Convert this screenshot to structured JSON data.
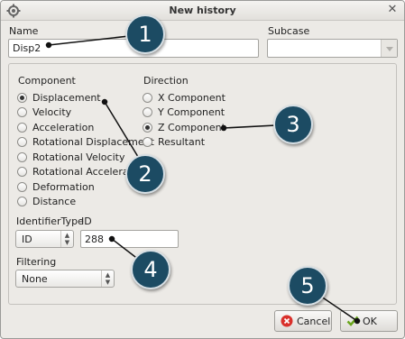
{
  "window": {
    "title": "New history",
    "icon": "gear-icon",
    "close_icon": "close-icon"
  },
  "name": {
    "label": "Name",
    "value": "Disp2"
  },
  "subcase": {
    "label": "Subcase",
    "value": ""
  },
  "component": {
    "label": "Component",
    "selected": "Displacement",
    "options": [
      "Displacement",
      "Velocity",
      "Acceleration",
      "Rotational Displacement",
      "Rotational Velocity",
      "Rotational Acceleration",
      "Deformation",
      "Distance"
    ]
  },
  "direction": {
    "label": "Direction",
    "selected": "Z Component",
    "options": [
      "X Component",
      "Y Component",
      "Z Component",
      "Resultant"
    ]
  },
  "identifier_type": {
    "label": "IdentifierType",
    "value": "ID"
  },
  "id": {
    "label": "ID",
    "value": "288"
  },
  "filtering": {
    "label": "Filtering",
    "value": "None"
  },
  "buttons": {
    "cancel": "Cancel",
    "ok": "OK"
  },
  "callouts": [
    "1",
    "2",
    "3",
    "4",
    "5"
  ]
}
